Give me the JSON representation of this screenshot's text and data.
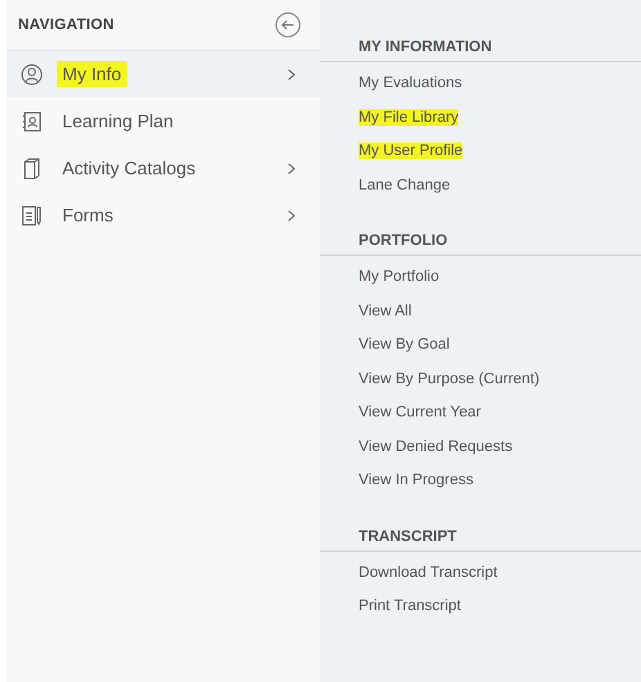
{
  "navigation": {
    "title": "NAVIGATION",
    "items": [
      {
        "label": "My Info",
        "selected": true,
        "highlighted": true,
        "has_submenu": true
      },
      {
        "label": "Learning Plan",
        "selected": false,
        "highlighted": false,
        "has_submenu": false
      },
      {
        "label": "Activity Catalogs",
        "selected": false,
        "highlighted": false,
        "has_submenu": true
      },
      {
        "label": "Forms",
        "selected": false,
        "highlighted": false,
        "has_submenu": true
      }
    ]
  },
  "submenu": {
    "sections": [
      {
        "title": "MY INFORMATION",
        "items": [
          {
            "label": "My Evaluations",
            "highlighted": false
          },
          {
            "label": "My File Library",
            "highlighted": true
          },
          {
            "label": "My User Profile",
            "highlighted": true
          },
          {
            "label": "Lane Change",
            "highlighted": false
          }
        ]
      },
      {
        "title": "PORTFOLIO",
        "items": [
          {
            "label": "My Portfolio",
            "highlighted": false
          },
          {
            "label": "View All",
            "highlighted": false
          },
          {
            "label": "View By Goal",
            "highlighted": false
          },
          {
            "label": "View By Purpose (Current)",
            "highlighted": false
          },
          {
            "label": "View Current Year",
            "highlighted": false
          },
          {
            "label": "View Denied Requests",
            "highlighted": false
          },
          {
            "label": "View In Progress",
            "highlighted": false
          }
        ]
      },
      {
        "title": "TRANSCRIPT",
        "items": [
          {
            "label": "Download Transcript",
            "highlighted": false
          },
          {
            "label": "Print Transcript",
            "highlighted": false
          }
        ]
      }
    ]
  }
}
